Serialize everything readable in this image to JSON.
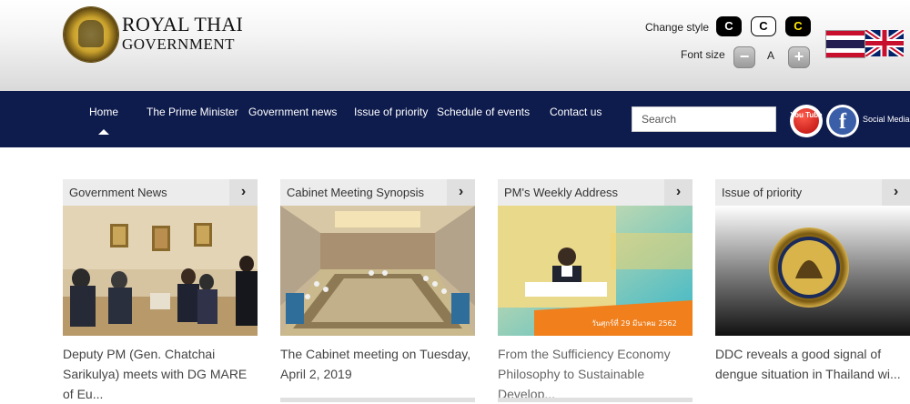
{
  "header": {
    "brand_line1": "ROYAL THAI",
    "brand_line2": "GOVERNMENT",
    "change_style_label": "Change style",
    "style_buttons": [
      "C",
      "C",
      "C"
    ],
    "font_size_label": "Font size",
    "font_minus": "−",
    "font_a": "A",
    "font_plus": "+"
  },
  "nav": {
    "items": [
      "Home",
      "The Prime Minister",
      "Government news",
      "Issue of priority",
      "Schedule of events",
      "Contact us"
    ],
    "search_placeholder": "Search",
    "youtube_text": "You Tube",
    "facebook_text": "f",
    "social_label": "Social Media"
  },
  "cards": [
    {
      "title": "Government News",
      "text": "Deputy PM (Gen. Chatchai Sarikulya) meets with DG MARE of Eu..."
    },
    {
      "title": "Cabinet Meeting Synopsis",
      "text": "The Cabinet meeting on Tuesday, April 2, 2019"
    },
    {
      "title": "PM's Weekly Address",
      "text": "From the Sufficiency Economy Philosophy to Sustainable Develop...",
      "img_text_top": "วันศุกร์ที่ 29 มีนาคม 2562"
    },
    {
      "title": "Issue of priority",
      "text": "DDC reveals a good signal of dengue situation in Thailand wi..."
    }
  ],
  "colors": {
    "nav_bg": "#0e1b4d",
    "card_header_bg": "#ececec",
    "address_orange": "#f07f1c"
  }
}
